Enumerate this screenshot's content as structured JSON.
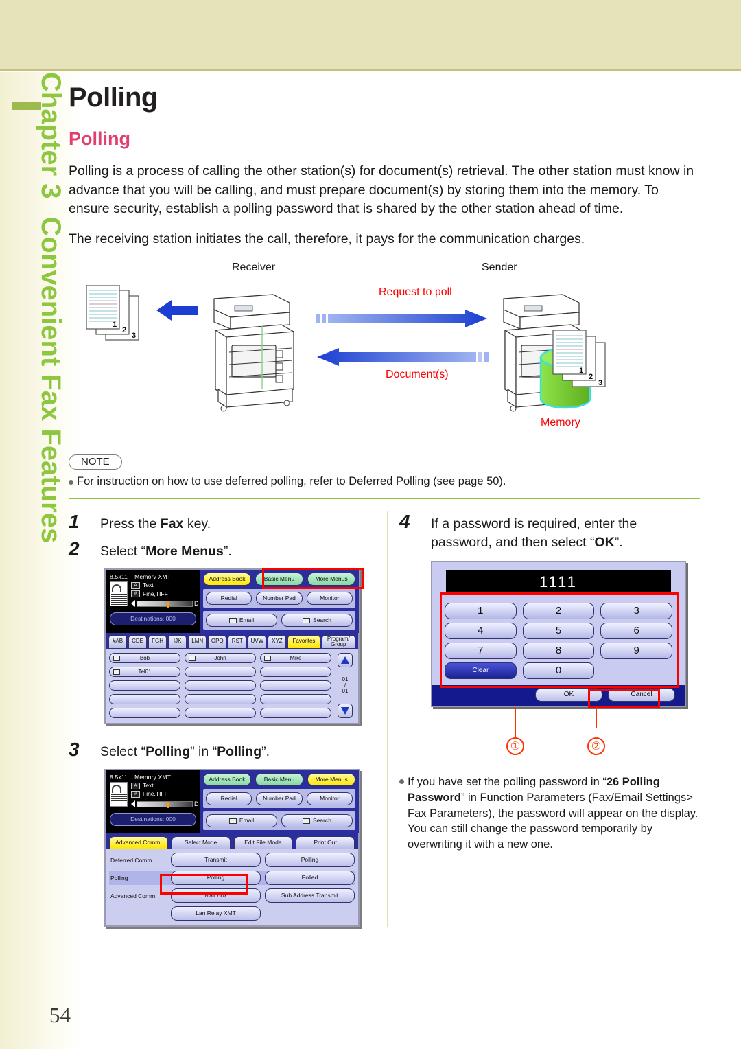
{
  "sidebar": {
    "chapter_label": "Chapter 3",
    "chapter_title": "Convenient Fax Features",
    "accent_color": "#8dc63f"
  },
  "page": {
    "title": "Polling",
    "section_title": "Polling",
    "page_number": "54",
    "section_color": "#e04070",
    "paragraphs": [
      "Polling is a process of calling the other station(s) for document(s) retrieval. The other station must know in advance that you will be calling, and must prepare document(s) by storing them into the memory. To ensure security, establish a polling password that is shared by the other station ahead of time.",
      "The receiving station initiates the call, therefore, it pays for the communication charges."
    ]
  },
  "diagram": {
    "receiver_label": "Receiver",
    "sender_label": "Sender",
    "request_label": "Request to poll",
    "documents_label": "Document(s)",
    "memory_label": "Memory",
    "page_marks": [
      "1",
      "2",
      "3"
    ],
    "arrow_color": "#1b3fd1",
    "label_color": "#ff0000"
  },
  "note": {
    "badge": "NOTE",
    "text": "For instruction on how to use deferred polling, refer to Deferred Polling (see page 50)."
  },
  "steps": {
    "step1": {
      "num": "1",
      "text_pre": "Press the ",
      "bold": "Fax",
      "text_post": " key."
    },
    "step2": {
      "num": "2",
      "text_pre": "Select “",
      "bold": "More Menus",
      "text_post": "”."
    },
    "step3": {
      "num": "3",
      "text_pre": "Select “",
      "bold1": "Polling",
      "text_mid": "” in “",
      "bold2": "Polling",
      "text_post": "”."
    },
    "step4": {
      "num": "4",
      "text_pre": "If a password is required, enter the password, and then select “",
      "bold": "OK",
      "text_post": "”."
    }
  },
  "lcd1": {
    "status": {
      "paper_size": "8.5x11",
      "mode": "Memory XMT",
      "quality": "Text",
      "resolution": "Fine,TIFF",
      "density_right": "D",
      "destinations": "Destinations: 000"
    },
    "top_buttons": [
      "Address Book",
      "Basic Menu",
      "More Menus"
    ],
    "row2_buttons": [
      "Redial",
      "Number Pad",
      "Monitor"
    ],
    "row3_buttons": [
      "Email",
      "Search"
    ],
    "alpha_tabs": [
      "#AB",
      "CDE",
      "FGH",
      "IJK",
      "LMN",
      "OPQ",
      "RST",
      "UVW",
      "XYZ"
    ],
    "favorites_tab": "Favorites",
    "program_tab_line1": "Program/",
    "program_tab_line2": "Group",
    "entries": [
      [
        "Bob",
        "John",
        "Mike"
      ],
      [
        "Tel01",
        "",
        ""
      ],
      [
        "",
        "",
        ""
      ],
      [
        "",
        "",
        ""
      ],
      [
        "",
        "",
        ""
      ]
    ],
    "page_indicator": [
      "01",
      "/",
      "01"
    ],
    "highlight": "More Menus"
  },
  "lcd2": {
    "status": {
      "paper_size": "8.5x11",
      "mode": "Memory XMT",
      "quality": "Text",
      "resolution": "Fine,TIFF",
      "density_right": "D",
      "destinations": "Destinations: 000"
    },
    "top_buttons": [
      "Address Book",
      "Basic Menu",
      "More Menus"
    ],
    "row2_buttons": [
      "Redial",
      "Number Pad",
      "Monitor"
    ],
    "row3_buttons": [
      "Email",
      "Search"
    ],
    "menu_tabs": [
      "Advanced Comm.",
      "Select Mode",
      "Edit File Mode",
      "Print Out"
    ],
    "active_tab": "Advanced Comm.",
    "menu_rows": [
      {
        "label": "Deferred Comm.",
        "buttons": [
          "Transmit",
          "Polling"
        ],
        "highlighted": false
      },
      {
        "label": "Polling",
        "buttons": [
          "Polling",
          "Polled"
        ],
        "highlighted": true
      },
      {
        "label": "Advanced Comm.",
        "buttons": [
          "Mail Box",
          "Sub Address Transmit"
        ],
        "highlighted": false
      },
      {
        "label": "",
        "buttons": [
          "Lan Relay XMT",
          ""
        ],
        "highlighted": false
      }
    ],
    "highlight": "Polling"
  },
  "keypad": {
    "display_value": "1111",
    "keys": [
      [
        "1",
        "2",
        "3"
      ],
      [
        "4",
        "5",
        "6"
      ],
      [
        "7",
        "8",
        "9"
      ],
      [
        "Clear",
        "0",
        ""
      ]
    ],
    "ok_label": "OK",
    "cancel_label": "Cancel",
    "callouts": [
      "①",
      "②"
    ]
  },
  "right_note": {
    "pre": "If you have set the polling password in “",
    "bold": "26 Polling Password",
    "post": "” in Function Parameters (Fax/Email Settings> Fax Parameters), the password will appear on the display. You can still change the password temporarily by overwriting it with a new one."
  }
}
